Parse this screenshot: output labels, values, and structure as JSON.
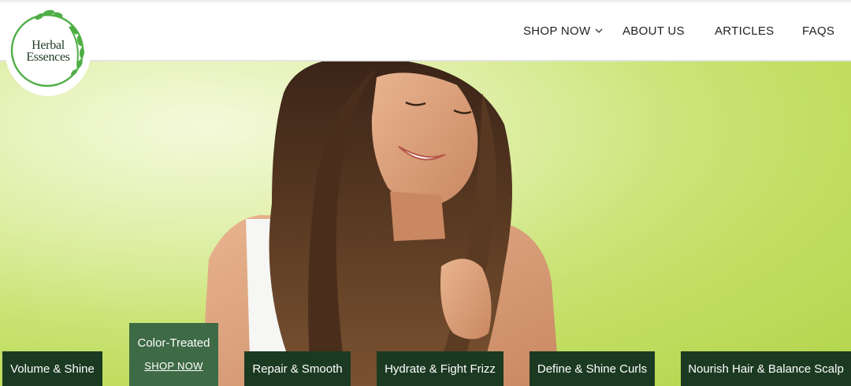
{
  "brand": {
    "name_line1": "Herbal",
    "name_line2": "Essences",
    "colors": {
      "leaf": "#4fae45",
      "text": "#1f3a24"
    }
  },
  "nav": {
    "shop_now": "SHOP NOW",
    "about_us": "ABOUT US",
    "articles": "ARTICLES",
    "faqs": "FAQS"
  },
  "hero": {
    "image": "woman-with-long-brown-hair-on-green-background"
  },
  "categories": [
    {
      "label": "Volume & Shine"
    },
    {
      "label": "Color-Treated",
      "cta": "SHOP NOW",
      "active": true
    },
    {
      "label": "Repair & Smooth"
    },
    {
      "label": "Hydrate & Fight Frizz"
    },
    {
      "label": "Define & Shine Curls"
    },
    {
      "label": "Nourish Hair & Balance Scalp"
    }
  ],
  "colors": {
    "category_bg": "#1c3a22",
    "category_active_bg": "#3e6a46",
    "hero_bg": "#c3df66"
  },
  "icons": {
    "dropdown": "chevron-down-icon"
  }
}
